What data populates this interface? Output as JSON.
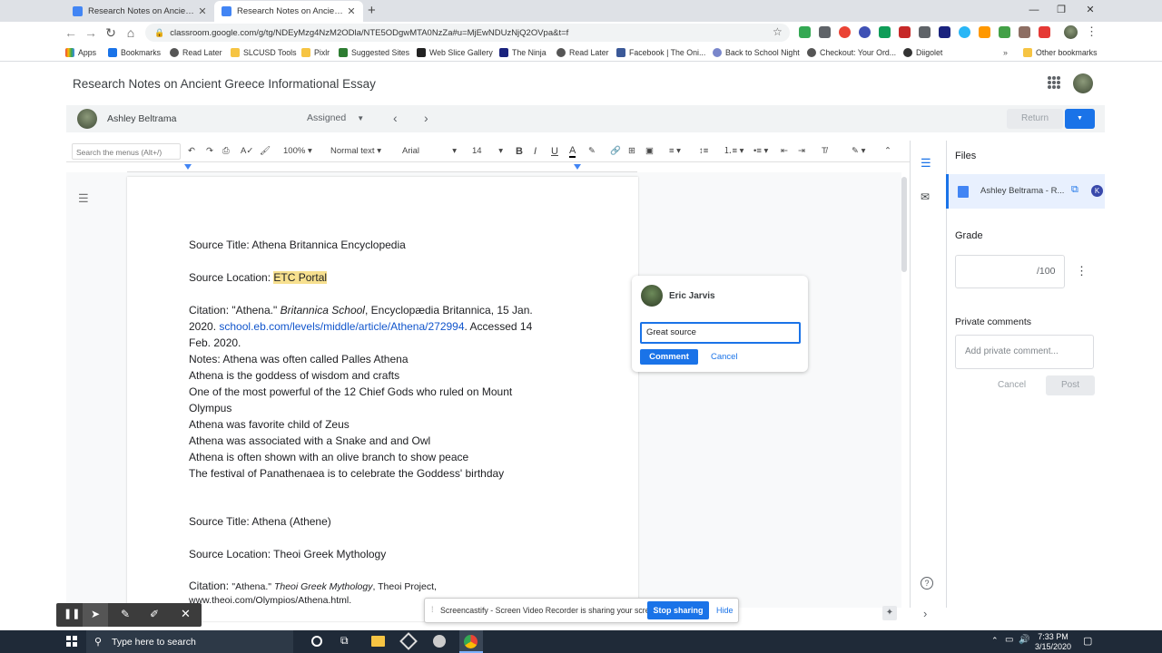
{
  "browser": {
    "tabs": [
      {
        "title": "Research Notes on Ancient Greec",
        "active": false
      },
      {
        "title": "Research Notes on Ancient Greec",
        "active": true
      }
    ],
    "new_tab_icon": "plus-icon",
    "url": "classroom.google.com/g/tg/NDEyMzg4NzM2ODla/NTE5ODgwMTA0NzZa#u=MjEwNDUzNjQ2OVpa&t=f",
    "bookmarks": [
      "Apps",
      "Bookmarks",
      "Read Later",
      "SLCUSD Tools",
      "Pixlr",
      "Suggested Sites",
      "Web Slice Gallery",
      "The Ninja",
      "Read Later",
      "Facebook | The Oni...",
      "Back to School Night",
      "Checkout: Your Ord...",
      "Diigolet"
    ],
    "other_bookmarks": "Other bookmarks"
  },
  "classroom": {
    "title": "Research Notes on Ancient Greece Informational Essay",
    "student_name": "Ashley Beltrama",
    "status": "Assigned",
    "return_label": "Return"
  },
  "toolbar": {
    "search_placeholder": "Search the menus (Alt+/)",
    "zoom": "100%",
    "style": "Normal text",
    "font": "Arial",
    "size": "14"
  },
  "document": {
    "lines": [
      "Source Title: Athena Britannica Encyclopedia",
      "Notes:  Athena was often called Palles Athena",
      "Athena is the goddess of wisdom and crafts",
      "One of the most powerful of the 12 Chief Gods who ruled on Mount",
      "Olympus",
      "Athena was favorite child of Zeus",
      "Athena was associated with a Snake and and Owl",
      "Athena is often shown with an olive branch to show peace",
      "The festival of Panathenaea is to celebrate the Goddess' birthday",
      "Source Title: Athena (Athene)",
      "Source Location: Theoi Greek Mythology"
    ],
    "location_label": "Source Location: ",
    "location_value": "ETC Portal",
    "citation1": {
      "prefix": "Citation: \"Athena.\" ",
      "italic": "Britannica School",
      "mid": ", Encyclopædia Britannica, 15 Jan.",
      "line2a": "2020. ",
      "link": "school.eb.com/levels/middle/article/Athena/272994",
      "line2b": ". Accessed 14",
      "line3": "Feb. 2020."
    },
    "citation2": {
      "prefix": "Citation: ",
      "quote": "\"Athena.\" ",
      "italic": "Theoi Greek Mythology",
      "rest": ", Theoi Project,",
      "line2": "www.theoi.com/Olympios/Athena.html."
    }
  },
  "comment": {
    "author": "Eric Jarvis",
    "text": "Great source",
    "submit": "Comment",
    "cancel": "Cancel"
  },
  "side_panel": {
    "files_heading": "Files",
    "file_name": "Ashley Beltrama - R...",
    "grade_heading": "Grade",
    "grade_suffix": "/100",
    "private_heading": "Private comments",
    "private_placeholder": "Add private comment...",
    "cancel": "Cancel",
    "post": "Post"
  },
  "screencastify": {
    "message": "Screencastify - Screen Video Recorder is sharing your screen.",
    "stop": "Stop sharing",
    "hide": "Hide"
  },
  "taskbar": {
    "search": "Type here to search",
    "time": "7:33 PM",
    "date": "3/15/2020"
  },
  "colors": {
    "accent_blue": "#1a73e8",
    "highlight": "#f7e08f",
    "link": "#1155cc"
  }
}
